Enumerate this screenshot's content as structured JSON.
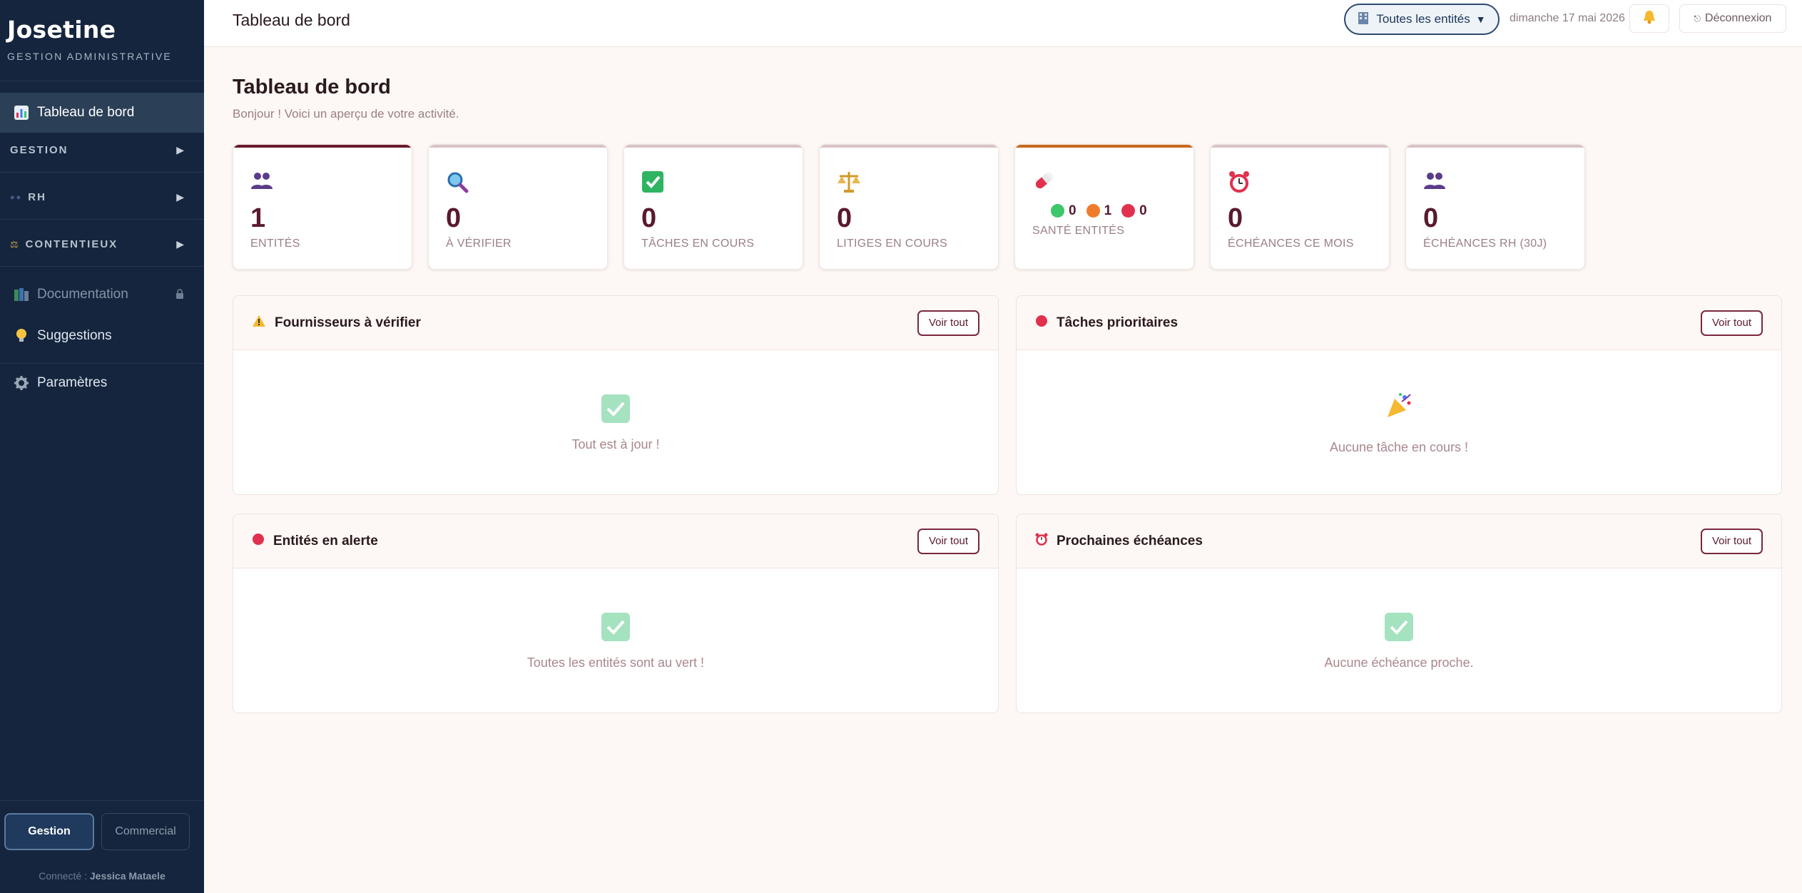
{
  "sidebar": {
    "brand_title": "Josetine",
    "brand_subtitle": "GESTION ADMINISTRATIVE",
    "active_item": {
      "label": "Tableau de bord",
      "icon": "bar-chart-icon"
    },
    "sections": [
      {
        "label": "GESTION",
        "icon": ""
      },
      {
        "label": "RH",
        "icon": "people-icon"
      },
      {
        "label": "CONTENTIEUX",
        "icon": "scales-icon"
      }
    ],
    "items": [
      {
        "label": "Documentation",
        "icon": "books-icon",
        "locked": true
      },
      {
        "label": "Suggestions",
        "icon": "lightbulb-icon"
      },
      {
        "label": "Paramètres",
        "icon": "gear-icon"
      }
    ],
    "mode_buttons": [
      "Gestion",
      "Commercial"
    ],
    "active_mode": "Gestion",
    "connected_prefix": "Connecté :",
    "connected_user": "Jessica Mataele"
  },
  "topbar": {
    "title": "Tableau de bord",
    "entity_select": "Toutes les entités",
    "date": "dimanche 17 mai 2026",
    "logout_label": "Déconnexion"
  },
  "page": {
    "title": "Tableau de bord",
    "subtitle": "Bonjour ! Voici un aperçu de votre activité."
  },
  "stats": [
    {
      "value": "1",
      "label": "ENTITÉS",
      "icon": "people-icon",
      "accent": "#6b1a2e"
    },
    {
      "value": "0",
      "label": "À VÉRIFIER",
      "icon": "magnifier-icon",
      "accent": "#d8c4c8"
    },
    {
      "value": "0",
      "label": "TÂCHES EN COURS",
      "icon": "check-box-icon",
      "accent": "#d8c4c8"
    },
    {
      "value": "0",
      "label": "LITIGES EN COURS",
      "icon": "scales-icon",
      "accent": "#d8c4c8"
    },
    {
      "label": "SANTÉ ENTITÉS",
      "icon": "pill-icon",
      "accent": "#c9691b",
      "green": "0",
      "orange": "1",
      "red": "0"
    },
    {
      "value": "0",
      "label": "ÉCHÉANCES CE MOIS",
      "icon": "alarm-clock-icon",
      "accent": "#d8c4c8"
    },
    {
      "value": "0",
      "label": "ÉCHÉANCES RH (30J)",
      "icon": "people-icon",
      "accent": "#d8c4c8"
    }
  ],
  "panels": [
    {
      "title": "Fournisseurs à vérifier",
      "icon": "warning-icon",
      "button": "Voir tout",
      "empty_text": "Tout est à jour !",
      "empty_icon": "check-box-icon"
    },
    {
      "title": "Tâches prioritaires",
      "icon": "red-circle-icon",
      "button": "Voir tout",
      "empty_text": "Aucune tâche en cours !",
      "empty_icon": "party-popper-icon"
    },
    {
      "title": "Entités en alerte",
      "icon": "red-circle-icon",
      "button": "Voir tout",
      "empty_text": "Toutes les entités sont au vert !",
      "empty_icon": "check-box-icon"
    },
    {
      "title": "Prochaines échéances",
      "icon": "alarm-clock-icon",
      "button": "Voir tout",
      "empty_text": "Aucune échéance proche.",
      "empty_icon": "check-box-icon"
    }
  ],
  "colors": {
    "sidebar_bg": "#14253d",
    "accent_maroon": "#5a1a2e",
    "health_green": "#3cc76a",
    "health_orange": "#f07b2c",
    "health_red": "#e0314f"
  }
}
